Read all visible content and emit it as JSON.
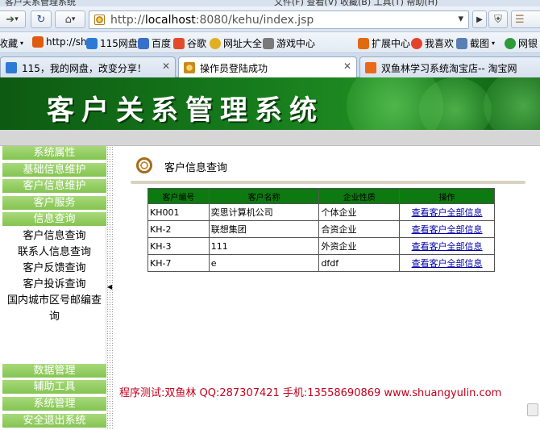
{
  "browser": {
    "top_strip": {
      "left_text": "客户关系管理系统",
      "right_text": "文件(F) 查看(V) 收藏(B) 工具(T) 帮助(H)"
    },
    "address_url_prefix": "http://",
    "address_url_host": "localhost",
    "address_url_rest": ":8080/kehu/index.jsp",
    "bookmarks_left": [
      "收藏",
      "http://sh",
      "115网盘",
      "百度",
      "谷歌",
      "网址大全",
      "游戏中心"
    ],
    "bookmarks_right": [
      "扩展中心",
      "我喜欢",
      "截图",
      "网银"
    ],
    "tabs": [
      {
        "label": "115，我的网盘，改变分享！"
      },
      {
        "label": "操作员登陆成功"
      },
      {
        "label": "双鱼林学习系统淘宝店-- 淘宝网"
      }
    ]
  },
  "banner": {
    "title": "客户关系管理系统"
  },
  "sidebar": {
    "menus": [
      {
        "label": "系统属性"
      },
      {
        "label": "基础信息维护"
      },
      {
        "label": "客户信息维护"
      },
      {
        "label": "客户服务"
      },
      {
        "label": "信息查询"
      }
    ],
    "sub_items": [
      {
        "label": "客户信息查询"
      },
      {
        "label": "联系人信息查询"
      },
      {
        "label": "客户反馈查询"
      },
      {
        "label": "客户投诉查询"
      },
      {
        "label": "国内城市区号邮编查"
      },
      {
        "label": "询"
      }
    ],
    "bottom_menus": [
      {
        "label": "数据管理"
      },
      {
        "label": "辅助工具"
      },
      {
        "label": "系统管理"
      },
      {
        "label": "安全退出系统"
      }
    ]
  },
  "main": {
    "title": "客户信息查询",
    "table": {
      "headers": [
        "客户编号",
        "客户名称",
        "企业性质",
        "操作"
      ],
      "rows": [
        {
          "id": "KH001",
          "name": "奕思计算机公司",
          "type": "个体企业",
          "action": "查看客户全部信息"
        },
        {
          "id": "KH-2",
          "name": "联想集团",
          "type": "合资企业",
          "action": "查看客户全部信息"
        },
        {
          "id": "KH-3",
          "name": "111",
          "type": "外资企业",
          "action": "查看客户全部信息"
        },
        {
          "id": "KH-7",
          "name": "e",
          "type": "dfdf",
          "action": "查看客户全部信息"
        }
      ]
    },
    "footer_note": "程序测试:双鱼林 QQ:287307421 手机:13558690869 www.shuangyulin.com"
  }
}
